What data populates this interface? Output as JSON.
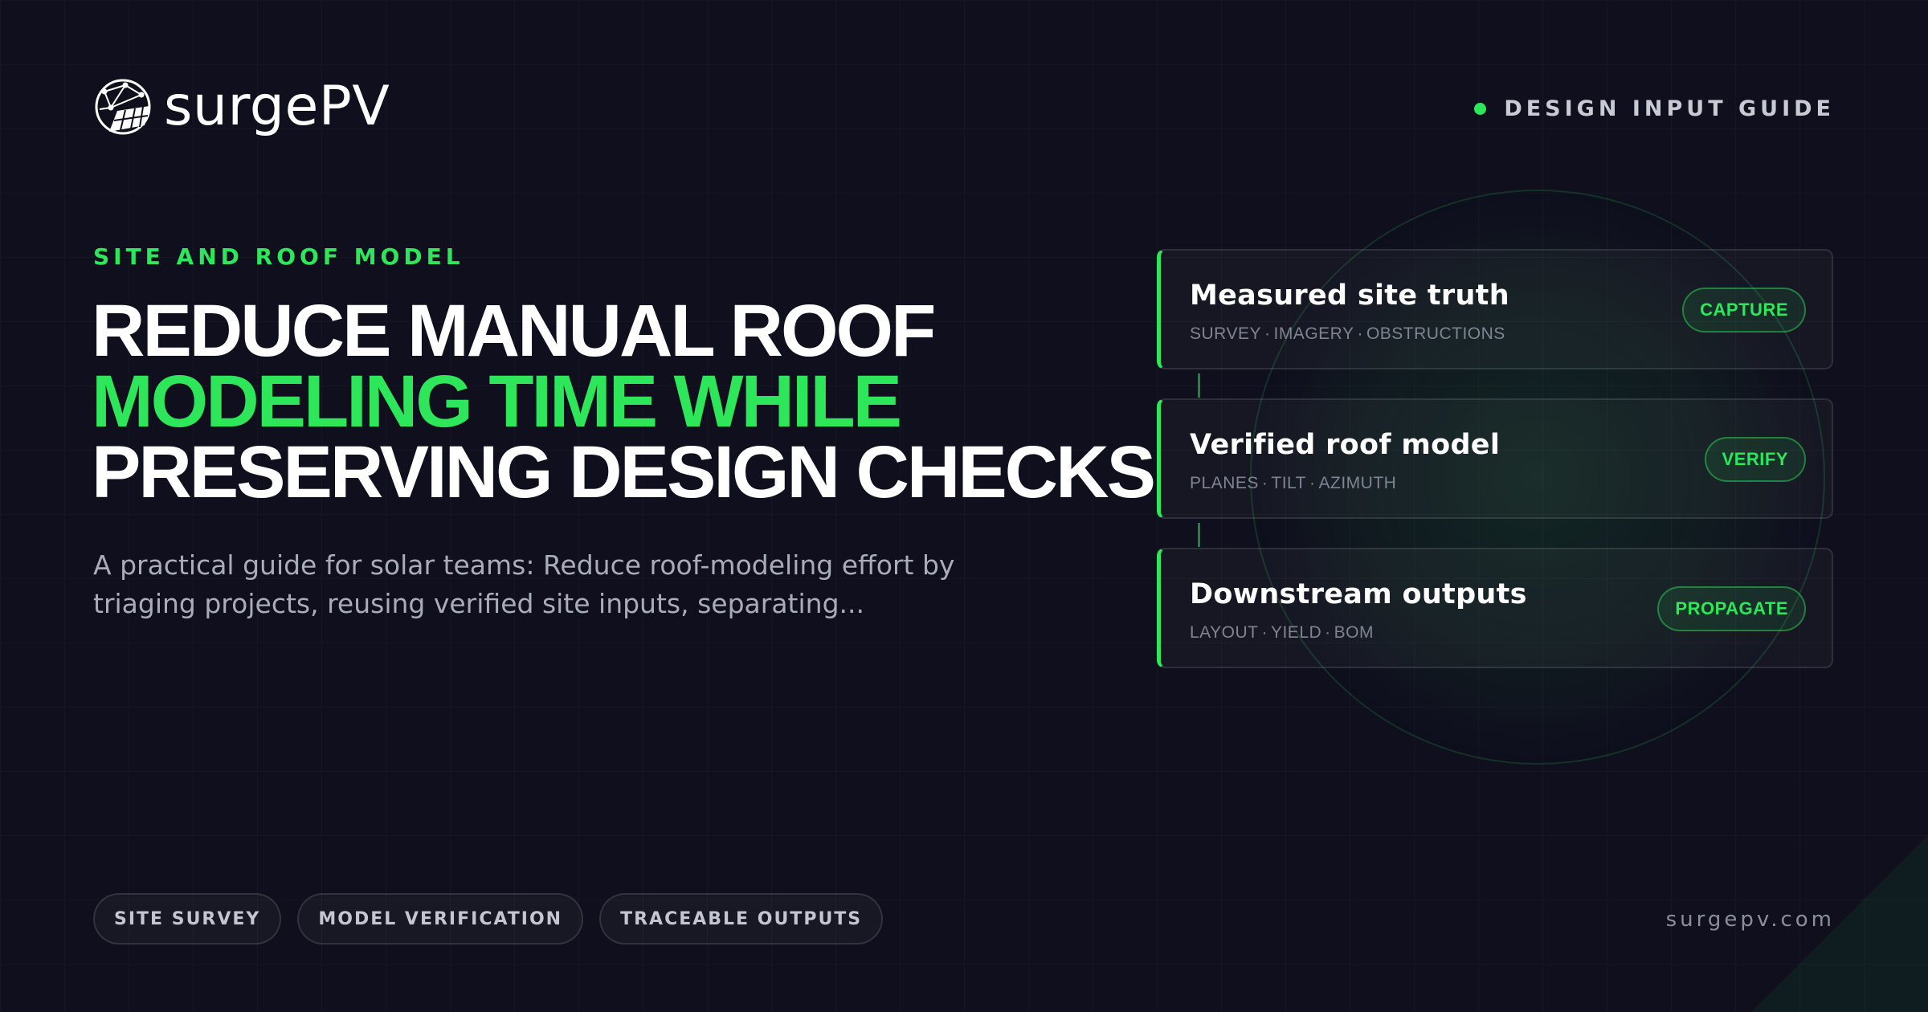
{
  "brand": {
    "name": "surgePV",
    "website": "surgepv.com"
  },
  "header": {
    "guide_label": "DESIGN INPUT GUIDE"
  },
  "hero": {
    "eyebrow": "SITE AND ROOF MODEL",
    "headline_lines": [
      "REDUCE MANUAL ROOF",
      "MODELING TIME WHILE",
      "PRESERVING DESIGN CHECKS"
    ],
    "description": "A practical guide for solar teams: Reduce roof-modeling effort by triaging projects, reusing verified site inputs, separating..."
  },
  "cards": [
    {
      "title": "Measured site truth",
      "tags": [
        "SURVEY",
        "IMAGERY",
        "OBSTRUCTIONS"
      ],
      "badge": "CAPTURE"
    },
    {
      "title": "Verified roof model",
      "tags": [
        "PLANES",
        "TILT",
        "AZIMUTH"
      ],
      "badge": "VERIFY"
    },
    {
      "title": "Downstream outputs",
      "tags": [
        "LAYOUT",
        "YIELD",
        "BOM"
      ],
      "badge": "PROPAGATE"
    }
  ],
  "chips": [
    "SITE SURVEY",
    "MODEL VERIFICATION",
    "TRACEABLE OUTPUTS"
  ],
  "colors": {
    "background": "#0f0f1d",
    "accent": "#2ee65a",
    "muted_text": "#a9adb9"
  },
  "icons": {
    "logo": "solar-globe-logo-icon",
    "status": "green-dot-icon"
  }
}
